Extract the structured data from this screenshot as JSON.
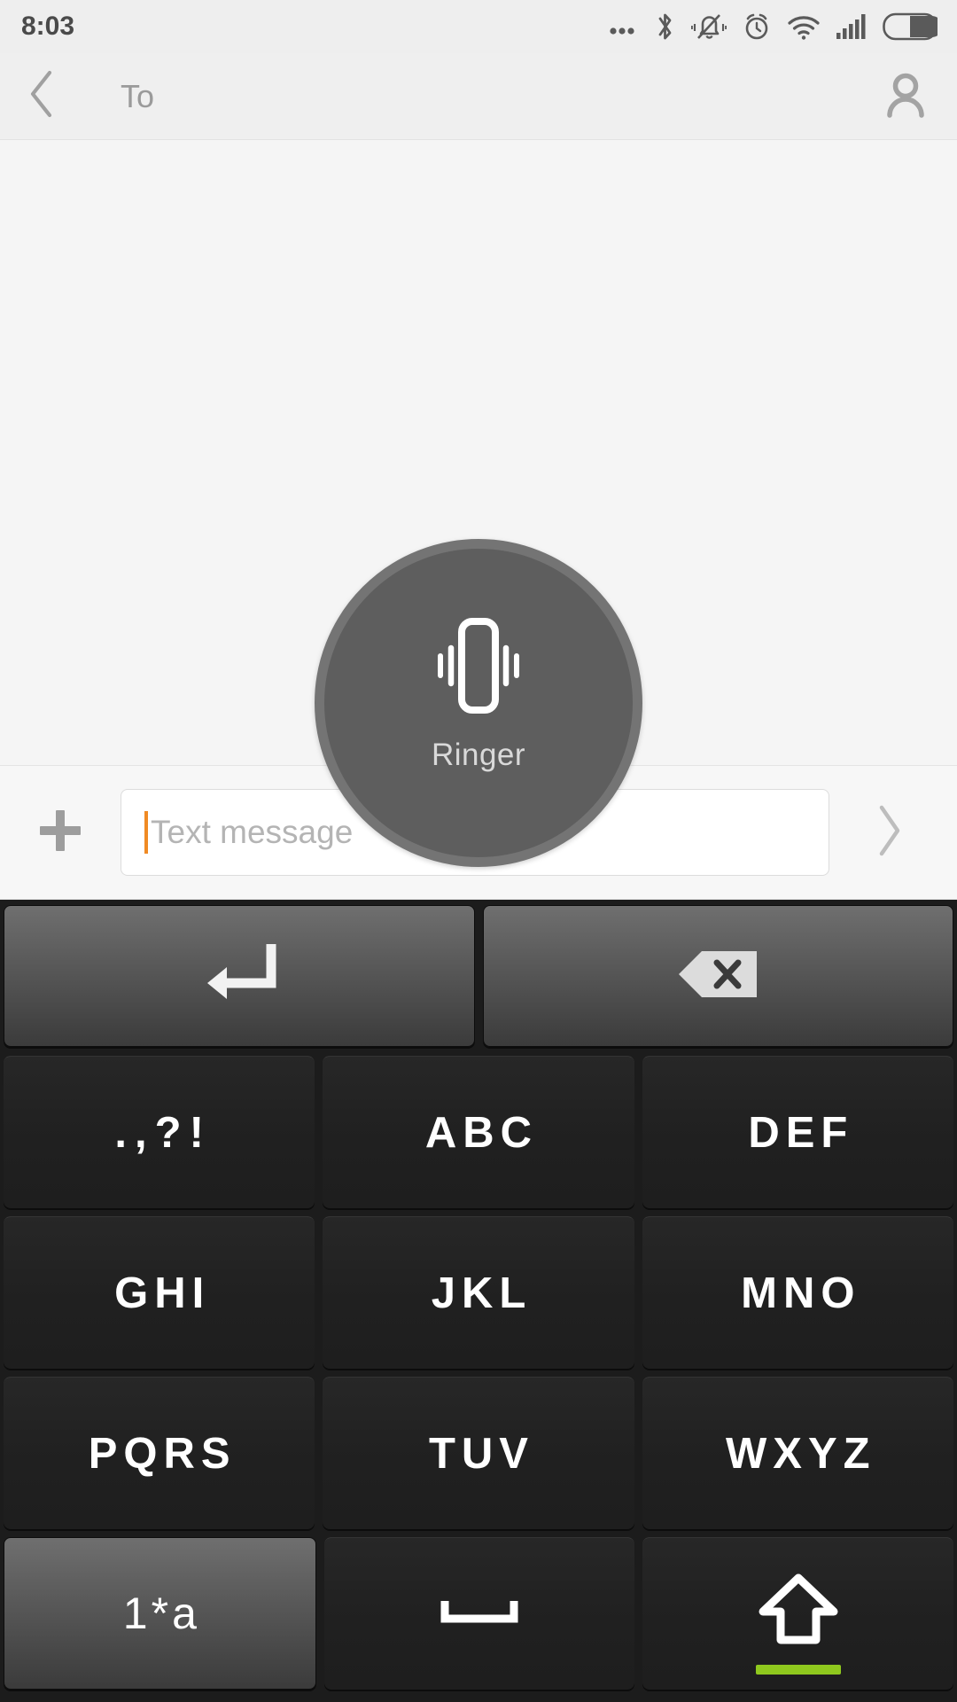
{
  "status_bar": {
    "time": "8:03",
    "icons": [
      {
        "name": "more-icon",
        "label": "more"
      },
      {
        "name": "bluetooth-icon",
        "label": "Bluetooth"
      },
      {
        "name": "vibrate-bell-icon",
        "label": "Silent vibrate"
      },
      {
        "name": "alarm-icon",
        "label": "Alarm"
      },
      {
        "name": "wifi-icon",
        "label": "Wi-Fi"
      },
      {
        "name": "cellular-signal-icon",
        "label": "Signal"
      },
      {
        "name": "battery-icon",
        "label": "Battery"
      }
    ]
  },
  "header": {
    "back_label": "Back",
    "to_placeholder": "To",
    "contacts_label": "Choose contact"
  },
  "compose": {
    "attach_label": "+",
    "message_value": "",
    "message_placeholder": "Text message",
    "send_label": "Send",
    "caret_color": "#f08a24"
  },
  "ringer_overlay": {
    "label": "Ringer",
    "mode": "vibrate",
    "icon": "vibrate-icon",
    "circle_color": "#5e5e5e",
    "ring_color": "#747474"
  },
  "keyboard": {
    "type": "t9-12key",
    "shift_indicator_color": "#8fc81e",
    "rows": [
      [
        {
          "name": "enter-key",
          "label": "",
          "icon": "enter-arrow-icon",
          "style": "func"
        },
        {
          "name": "backspace-key",
          "label": "",
          "icon": "backspace-icon",
          "style": "func"
        }
      ],
      [
        {
          "name": "key-punctuation",
          "label": ".,?!",
          "style": "dark"
        },
        {
          "name": "key-abc",
          "label": "ABC",
          "style": "dark"
        },
        {
          "name": "key-def",
          "label": "DEF",
          "style": "dark"
        }
      ],
      [
        {
          "name": "key-ghi",
          "label": "GHI",
          "style": "dark"
        },
        {
          "name": "key-jkl",
          "label": "JKL",
          "style": "dark"
        },
        {
          "name": "key-mno",
          "label": "MNO",
          "style": "dark"
        }
      ],
      [
        {
          "name": "key-pqrs",
          "label": "PQRS",
          "style": "dark"
        },
        {
          "name": "key-tuv",
          "label": "TUV",
          "style": "dark"
        },
        {
          "name": "key-wxyz",
          "label": "WXYZ",
          "style": "dark"
        }
      ],
      [
        {
          "name": "key-symbols-mode",
          "label": "1*a",
          "style": "func"
        },
        {
          "name": "key-space",
          "label": "",
          "icon": "space-icon",
          "style": "dark"
        },
        {
          "name": "key-shift",
          "label": "",
          "icon": "shift-up-arrow-icon",
          "style": "dark"
        }
      ]
    ]
  }
}
